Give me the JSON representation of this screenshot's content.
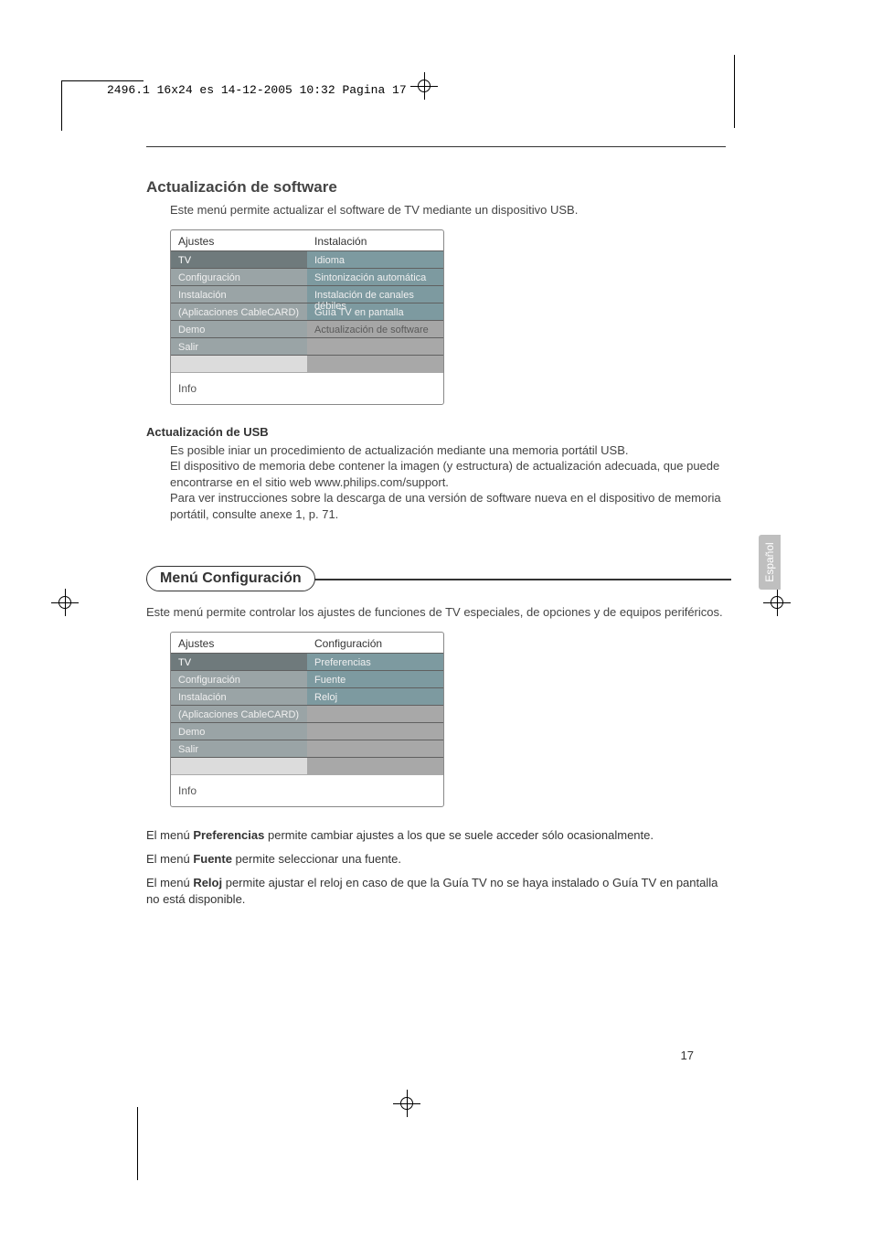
{
  "print_header": "2496.1 16x24 es  14-12-2005  10:32  Pagina 17",
  "side_tab": "Español",
  "page_number": "17",
  "section1": {
    "title": "Actualización de software",
    "intro": "Este menú permite actualizar el software de TV mediante un dispositivo USB.",
    "menu": {
      "left_header": "Ajustes",
      "right_header": "Instalación",
      "left_items": [
        "TV",
        "Configuración",
        "Instalación",
        "(Aplicaciones CableCARD)",
        "Demo",
        "Salir"
      ],
      "right_items": [
        "Idioma",
        "Sintonización automática",
        "Instalación de canales débiles",
        "Guía TV en pantalla",
        "Actualización de software"
      ],
      "info": "Info"
    },
    "sub_title": "Actualización de USB",
    "sub_body": "Es posible iniar un procedimiento de actualización mediante una memoria portátil USB.\nEl dispositivo de memoria debe contener la imagen (y estructura) de actualización adecuada, que puede encontrarse en el sitio web www.philips.com/support.\nPara ver instrucciones sobre la descarga de una versión de software nueva en el dispositivo de memoria portátil, consulte anexe 1, p. 71."
  },
  "section2": {
    "pill": "Menú Configuración",
    "intro": "Este menú permite controlar los ajustes de funciones de TV especiales, de opciones y de equipos periféricos.",
    "menu": {
      "left_header": "Ajustes",
      "right_header": "Configuración",
      "left_items": [
        "TV",
        "Configuración",
        "Instalación",
        "(Aplicaciones CableCARD)",
        "Demo",
        "Salir"
      ],
      "right_items": [
        "Preferencias",
        "Fuente",
        "Reloj"
      ],
      "info": "Info"
    },
    "p1_pre": "El menú ",
    "p1_b": "Preferencias",
    "p1_post": " permite cambiar ajustes a los que se suele acceder sólo ocasionalmente.",
    "p2_pre": "El menú ",
    "p2_b": "Fuente",
    "p2_post": " permite seleccionar una fuente.",
    "p3_pre": "El menú ",
    "p3_b": "Reloj",
    "p3_post": " permite ajustar el reloj en caso de que la Guía TV no se haya instalado o Guía TV en pantalla no está disponible."
  }
}
